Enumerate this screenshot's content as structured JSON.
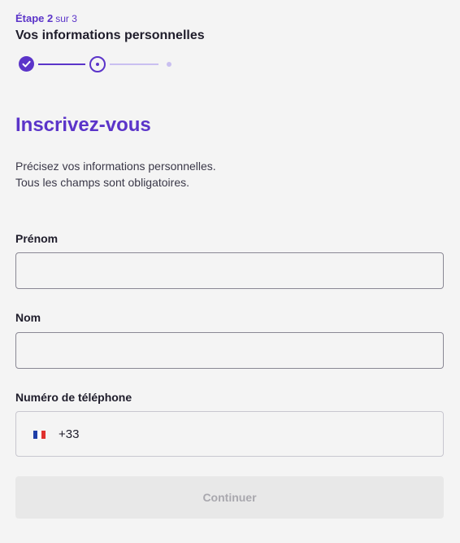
{
  "stepper": {
    "current_label": "Étape 2",
    "total_label": "sur 3",
    "title": "Vos informations personnelles",
    "steps": [
      {
        "status": "done",
        "icon": "check-icon"
      },
      {
        "status": "current",
        "icon": "dot-icon"
      },
      {
        "status": "pending",
        "icon": "dot-icon"
      }
    ]
  },
  "heading": "Inscrivez-vous",
  "intro": {
    "line1": "Précisez vos informations personnelles.",
    "line2": "Tous les champs sont obligatoires."
  },
  "fields": {
    "first_name": {
      "label": "Prénom",
      "value": ""
    },
    "last_name": {
      "label": "Nom",
      "value": ""
    },
    "phone": {
      "label": "Numéro de téléphone",
      "country_icon": "france-flag-icon",
      "dial_code": "+33",
      "value": ""
    }
  },
  "submit": {
    "label": "Continuer",
    "enabled": false
  },
  "colors": {
    "accent": "#5b34c9",
    "accent_light": "#c9bff0",
    "background": "#f4f4f4",
    "button_disabled_bg": "#e8e8e8",
    "button_disabled_text": "#a9a8ae"
  }
}
